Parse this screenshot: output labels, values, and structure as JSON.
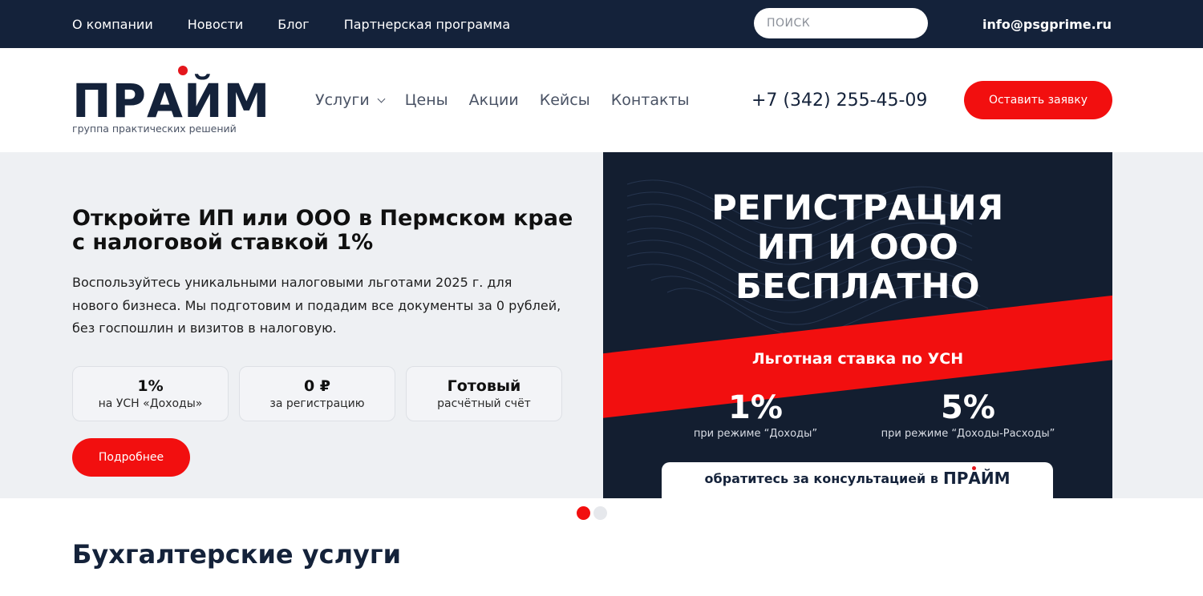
{
  "topbar": {
    "nav": [
      "О компании",
      "Новости",
      "Блог",
      "Партнерская программа"
    ],
    "search_placeholder": "ПОИСК",
    "email": "info@psgprime.ru"
  },
  "header": {
    "logo_text": "ПРАЙМ",
    "logo_subtitle": "группа практических решений",
    "nav": [
      "Услуги",
      "Цены",
      "Акции",
      "Кейсы",
      "Контакты"
    ],
    "phone": "+7 (342) 255-45-09",
    "cta_label": "Оставить заявку"
  },
  "hero": {
    "title": "Откройте ИП или ООО в Пермском крае с налоговой ставкой 1%",
    "text": "Воспользуйтесь уникальными налоговыми льготами 2025 г. для нового бизнеса. Мы подготовим и подадим все документы за 0 рублей, без госпошлин и визитов в налоговую.",
    "features": [
      {
        "value": "1%",
        "label": "на УСН «Доходы»"
      },
      {
        "value": "0 ₽",
        "label": "за регистрацию"
      },
      {
        "value": "Готовый",
        "label": "расчётный счёт"
      }
    ],
    "more_label": "Подробнее"
  },
  "banner": {
    "title_lines": [
      "РЕГИСТРАЦИЯ",
      "ИП И ООО",
      "БЕСПЛАТНО"
    ],
    "stripe_text": "Льготная ставка по УСН",
    "rates": [
      {
        "value": "1%",
        "label": "при режиме “Доходы”"
      },
      {
        "value": "5%",
        "label": "при режиме “Доходы-Расходы”"
      }
    ],
    "consult_text": "обратитесь за консультацией в",
    "consult_brand": "ПРАЙМ"
  },
  "slider": {
    "total": 2,
    "active": 1
  },
  "section": {
    "title": "Бухгалтерские услуги"
  },
  "colors": {
    "navy": "#14223a",
    "accent": "#f20f0f",
    "hero_bg": "#eef0f3"
  }
}
